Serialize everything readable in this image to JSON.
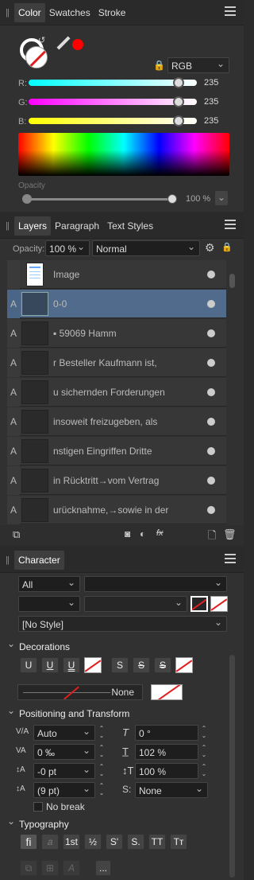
{
  "color_panel": {
    "tabs": [
      "Color",
      "Swatches",
      "Stroke"
    ],
    "model": "RGB",
    "channels": [
      {
        "label": "R:",
        "value": "235"
      },
      {
        "label": "G:",
        "value": "235"
      },
      {
        "label": "B:",
        "value": "235"
      }
    ],
    "opacity_label": "Opacity",
    "opacity_value": "100 %"
  },
  "layers_panel": {
    "tabs": [
      "Layers",
      "Paragraph",
      "Text Styles"
    ],
    "opacity_label": "Opacity:",
    "opacity_value": "100 %",
    "blend_mode": "Normal",
    "layers": [
      {
        "type": "",
        "name": "Image"
      },
      {
        "type": "A",
        "name": "0-0"
      },
      {
        "type": "A",
        "name": "▪ 59069 Hamm"
      },
      {
        "type": "A",
        "name": "r Besteller Kaufmann ist,"
      },
      {
        "type": "A",
        "name": "u sichernden Forderungen"
      },
      {
        "type": "A",
        "name": "insoweit freizugeben, als"
      },
      {
        "type": "A",
        "name": "nstigen Eingriffen Dritte"
      },
      {
        "type": "A",
        "name": "in Rücktritt→vom Vertrag"
      },
      {
        "type": "A",
        "name": "urücknahme,→sowie in der"
      }
    ]
  },
  "character_panel": {
    "tab": "Character",
    "font_collection": "All",
    "style": "[No Style]",
    "decorations_title": "Decorations",
    "underline_labels": [
      "U",
      "U",
      "U"
    ],
    "strike_labels": [
      "S",
      "S",
      "S"
    ],
    "line_none": "None",
    "positioning_title": "Positioning and Transform",
    "kerning": "Auto",
    "shear": "0 °",
    "tracking": "0 ‰",
    "vert_scale": "102 %",
    "baseline": "-0 pt",
    "horiz_scale": "100 %",
    "leading": "(9 pt)",
    "script": "None",
    "no_break": "No break",
    "typography_title": "Typography",
    "typo_buttons": [
      "fi",
      "𝑎",
      "1st",
      "½",
      "S'",
      "S.",
      "TT",
      "Tт"
    ],
    "more": "..."
  }
}
